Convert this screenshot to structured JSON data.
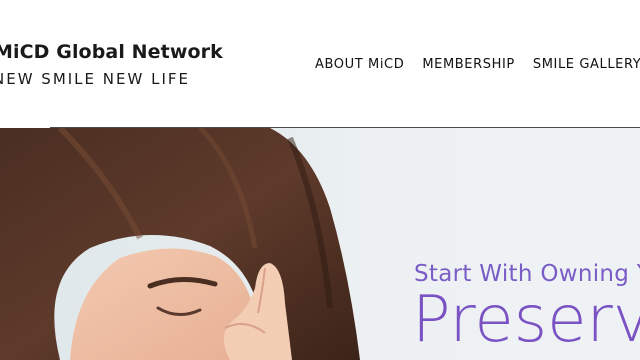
{
  "header": {
    "brand_name": "MiCD Global Network",
    "tagline": "NEW SMILE NEW LIFE"
  },
  "nav": {
    "items": [
      {
        "label": "ABOUT MiCD"
      },
      {
        "label": "MEMBERSHIP"
      },
      {
        "label": "SMILE GALLERY"
      }
    ]
  },
  "hero": {
    "subtitle": "Start With Owning Your Smile",
    "title": "Preserve"
  },
  "colors": {
    "accent": "#7b52c4",
    "text": "#1a1a1a",
    "hero_background": "#e6ecee"
  }
}
